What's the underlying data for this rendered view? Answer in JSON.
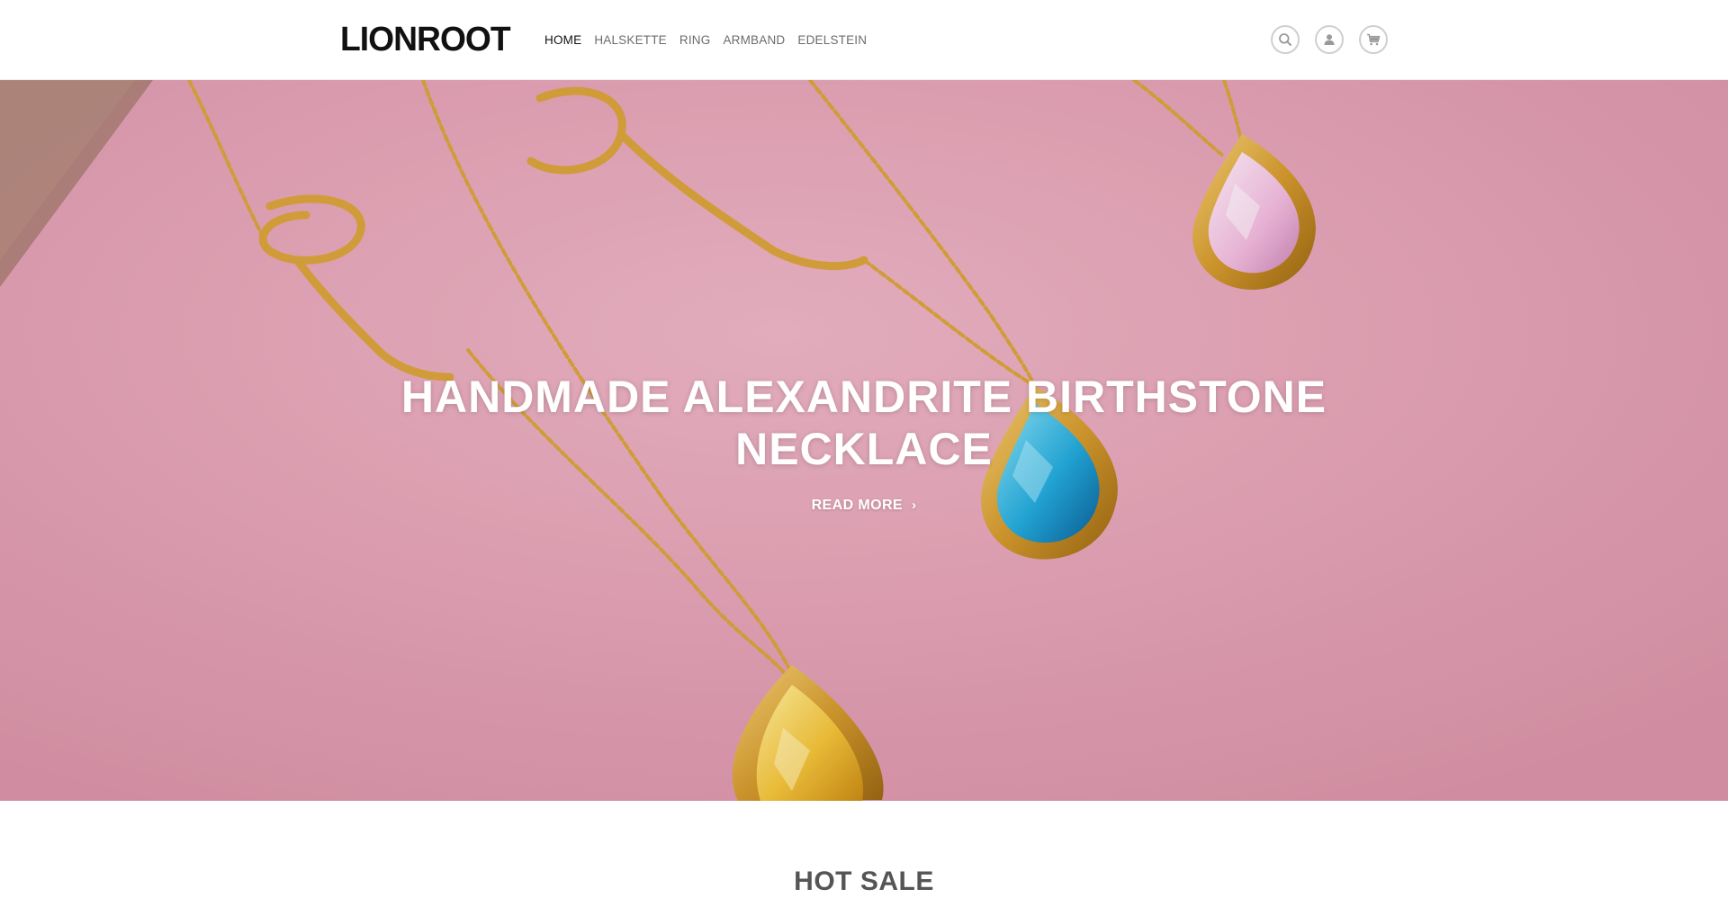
{
  "brand": {
    "logo_text": "LIONROOT"
  },
  "nav": {
    "items": [
      {
        "label": "HOME",
        "active": true
      },
      {
        "label": "HALSKETTE",
        "active": false
      },
      {
        "label": "RING",
        "active": false
      },
      {
        "label": "ARMBAND",
        "active": false
      },
      {
        "label": "EDELSTEIN",
        "active": false
      }
    ]
  },
  "header_icons": [
    "search-icon",
    "account-icon",
    "cart-icon"
  ],
  "hero": {
    "title": "HANDMADE ALEXANDRITE BIRTHSTONE NECKLACE",
    "cta_label": "READ MORE",
    "cta_icon": "chevron-right-icon",
    "background_color": "#e3a0b4"
  },
  "sections": {
    "hot_sale_title": "HOT SALE"
  },
  "colors": {
    "gold": "#d8a33a",
    "gem_blue": "#2fb2dd",
    "gem_yellow": "#f2c23a",
    "gem_pink": "#f0b9dc"
  }
}
